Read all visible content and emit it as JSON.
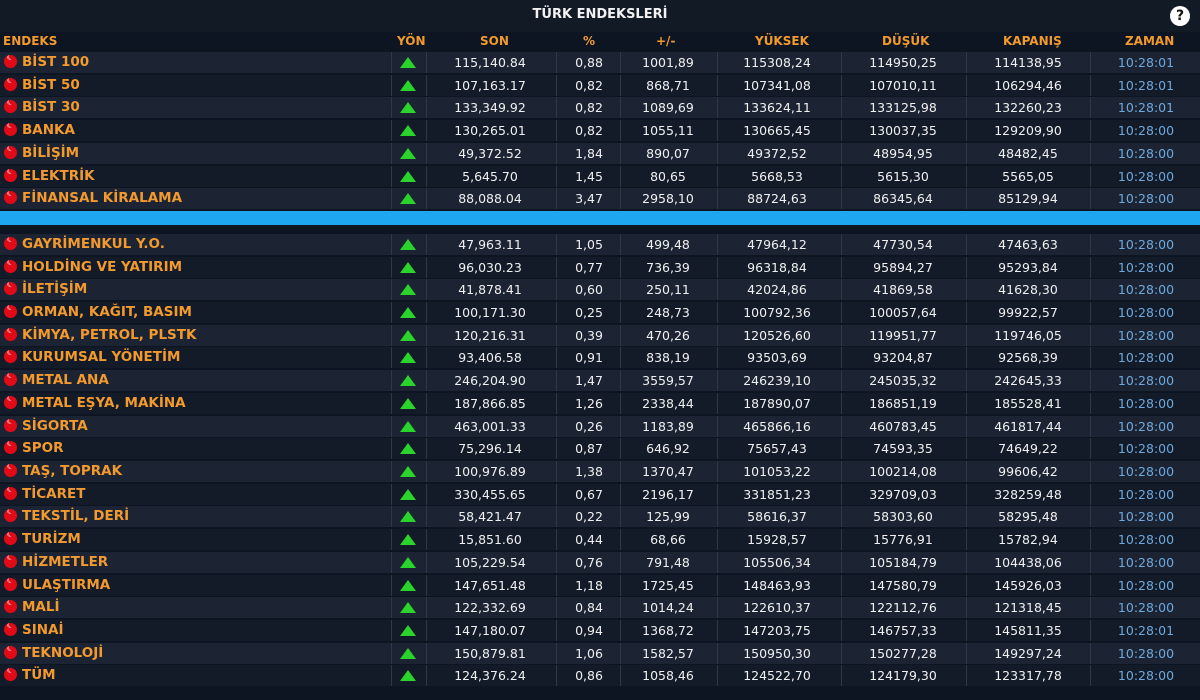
{
  "window": {
    "title": "TÜRK ENDEKSLERİ",
    "help_label": "?"
  },
  "columns": [
    "ENDEKS",
    "YÖN",
    "SON",
    "%",
    "+/-",
    "YÜKSEK",
    "DÜŞÜK",
    "KAPANIŞ",
    "ZAMAN"
  ],
  "rows_top": [
    [
      "BİST 100",
      "115,140.84",
      "0,88",
      "1001,89",
      "115308,24",
      "114950,25",
      "114138,95",
      "10:28:01"
    ],
    [
      "BİST 50",
      "107,163.17",
      "0,82",
      "868,71",
      "107341,08",
      "107010,11",
      "106294,46",
      "10:28:01"
    ],
    [
      "BİST 30",
      "133,349.92",
      "0,82",
      "1089,69",
      "133624,11",
      "133125,98",
      "132260,23",
      "10:28:01"
    ],
    [
      "BANKA",
      "130,265.01",
      "0,82",
      "1055,11",
      "130665,45",
      "130037,35",
      "129209,90",
      "10:28:00"
    ],
    [
      "BİLİŞİM",
      "49,372.52",
      "1,84",
      "890,07",
      "49372,52",
      "48954,95",
      "48482,45",
      "10:28:00"
    ],
    [
      "ELEKTRİK",
      "5,645.70",
      "1,45",
      "80,65",
      "5668,53",
      "5615,30",
      "5565,05",
      "10:28:00"
    ],
    [
      "FİNANSAL KİRALAMA",
      "88,088.04",
      "3,47",
      "2958,10",
      "88724,63",
      "86345,64",
      "85129,94",
      "10:28:00"
    ]
  ],
  "rows_bottom": [
    [
      "GAYRİMENKUL Y.O.",
      "47,963.11",
      "1,05",
      "499,48",
      "47964,12",
      "47730,54",
      "47463,63",
      "10:28:00"
    ],
    [
      "HOLDİNG VE YATIRIM",
      "96,030.23",
      "0,77",
      "736,39",
      "96318,84",
      "95894,27",
      "95293,84",
      "10:28:00"
    ],
    [
      "İLETİŞİM",
      "41,878.41",
      "0,60",
      "250,11",
      "42024,86",
      "41869,58",
      "41628,30",
      "10:28:00"
    ],
    [
      "ORMAN, KAĞIT, BASIM",
      "100,171.30",
      "0,25",
      "248,73",
      "100792,36",
      "100057,64",
      "99922,57",
      "10:28:00"
    ],
    [
      "KİMYA, PETROL, PLSTK",
      "120,216.31",
      "0,39",
      "470,26",
      "120526,60",
      "119951,77",
      "119746,05",
      "10:28:00"
    ],
    [
      "KURUMSAL YÖNETİM",
      "93,406.58",
      "0,91",
      "838,19",
      "93503,69",
      "93204,87",
      "92568,39",
      "10:28:00"
    ],
    [
      "METAL ANA",
      "246,204.90",
      "1,47",
      "3559,57",
      "246239,10",
      "245035,32",
      "242645,33",
      "10:28:00"
    ],
    [
      "METAL EŞYA, MAKİNA",
      "187,866.85",
      "1,26",
      "2338,44",
      "187890,07",
      "186851,19",
      "185528,41",
      "10:28:00"
    ],
    [
      "SİGORTA",
      "463,001.33",
      "0,26",
      "1183,89",
      "465866,16",
      "460783,45",
      "461817,44",
      "10:28:00"
    ],
    [
      "SPOR",
      "75,296.14",
      "0,87",
      "646,92",
      "75657,43",
      "74593,35",
      "74649,22",
      "10:28:00"
    ],
    [
      "TAŞ, TOPRAK",
      "100,976.89",
      "1,38",
      "1370,47",
      "101053,22",
      "100214,08",
      "99606,42",
      "10:28:00"
    ],
    [
      "TİCARET",
      "330,455.65",
      "0,67",
      "2196,17",
      "331851,23",
      "329709,03",
      "328259,48",
      "10:28:00"
    ],
    [
      "TEKSTİL, DERİ",
      "58,421.47",
      "0,22",
      "125,99",
      "58616,37",
      "58303,60",
      "58295,48",
      "10:28:00"
    ],
    [
      "TURİZM",
      "15,851.60",
      "0,44",
      "68,66",
      "15928,57",
      "15776,91",
      "15782,94",
      "10:28:00"
    ],
    [
      "HİZMETLER",
      "105,229.54",
      "0,76",
      "791,48",
      "105506,34",
      "105184,79",
      "104438,06",
      "10:28:00"
    ],
    [
      "ULAŞTIRMA",
      "147,651.48",
      "1,18",
      "1725,45",
      "148463,93",
      "147580,79",
      "145926,03",
      "10:28:00"
    ],
    [
      "MALİ",
      "122,332.69",
      "0,84",
      "1014,24",
      "122610,37",
      "122112,76",
      "121318,45",
      "10:28:00"
    ],
    [
      "SINAİ",
      "147,180.07",
      "0,94",
      "1368,72",
      "147203,75",
      "146757,33",
      "145811,35",
      "10:28:01"
    ],
    [
      "TEKNOLOJİ",
      "150,879.81",
      "1,06",
      "1582,57",
      "150950,30",
      "150277,28",
      "149297,24",
      "10:28:00"
    ],
    [
      "TÜM",
      "124,376.24",
      "0,86",
      "1058,46",
      "124522,70",
      "124179,30",
      "123317,78",
      "10:28:00"
    ]
  ],
  "colors": {
    "accent": "#f29a2e",
    "up": "#2bd42b",
    "time": "#6fa8dc",
    "highlight": "#1ea7f0"
  },
  "icons": {
    "flag": "turkish-flag-icon",
    "direction": "up-arrow-icon"
  }
}
